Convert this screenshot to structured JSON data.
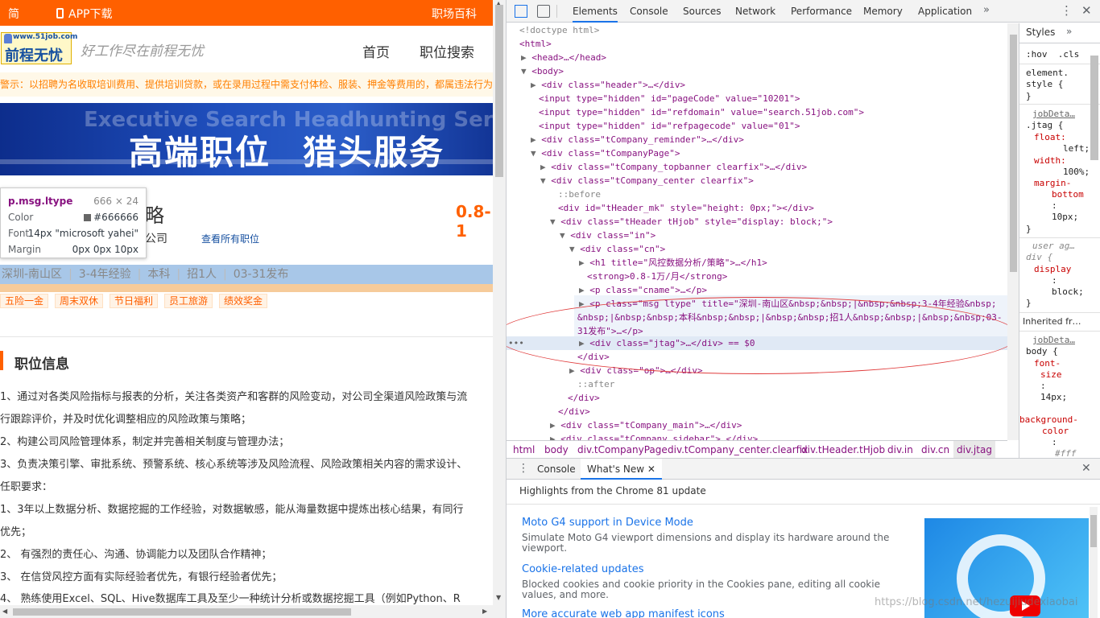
{
  "site": {
    "topbar": {
      "simplified": "简",
      "app_download": "APP下载",
      "career_wiki": "职场百科"
    },
    "logo": {
      "url_text": "www.51job.com",
      "name": "前程无忧"
    },
    "slogan": "好工作尽在前程无忧",
    "nav": [
      "首页",
      "职位搜索"
    ],
    "warning": "警示：以招聘为名收取培训费用、提供培训贷款，或在录用过程中需支付体检、服装、押金等费用的，都属违法行为",
    "banner": {
      "bg_text": "Executive Search  Headhunting Service",
      "title_left": "高端职位",
      "title_right": "猎头服务"
    },
    "job": {
      "title_tail": "略",
      "salary": "0.8-1",
      "company_tail": "公司",
      "view_all": "查看所有职位",
      "msg": [
        "深圳-南山区",
        "3-4年经验",
        "本科",
        "招1人",
        "03-31发布"
      ],
      "tags": [
        "五险一金",
        "周末双休",
        "节日福利",
        "员工旅游",
        "绩效奖金"
      ]
    },
    "section_title": "职位信息",
    "description": [
      "1、通过对各类风险指标与报表的分析，关注各类资产和客群的风险变动，对公司全渠道风险政策与流",
      "行跟踪评价，并及时优化调整相应的风险政策与策略；",
      "2、构建公司风险管理体系，制定并完善相关制度与管理办法；",
      "3、负责决策引擎、审批系统、预警系统、核心系统等涉及风险流程、风险政策相关内容的需求设计、",
      "任职要求：",
      "1、3年以上数据分析、数据挖掘的工作经验，对数据敏感，能从海量数据中提炼出核心结果，有同行",
      "优先；",
      "2、 有强烈的责任心、沟通、协调能力以及团队合作精神；",
      "3、 在信贷风控方面有实际经验者优先，有银行经验者优先；",
      "4、 熟练使用Excel、SQL、Hive数据库工具及至少一种统计分析或数据挖掘工具（例如Python、R"
    ]
  },
  "tooltip": {
    "selector": "p.msg.ltype",
    "dimensions": "666 × 24",
    "color_label": "Color",
    "color_value": "#666666",
    "font_label": "Font",
    "font_value": "14px \"microsoft yahei\"",
    "margin_label": "Margin",
    "margin_value": "0px 0px 10px"
  },
  "devtools": {
    "tabs": [
      "Elements",
      "Console",
      "Sources",
      "Network",
      "Performance",
      "Memory",
      "Application"
    ],
    "active_tab": "Elements",
    "more": "»",
    "dom_lines": [
      "<!doctype html>",
      "<html>",
      "<head>…</head>",
      "<body>",
      "<div class=\"header\">…</div>",
      "<input type=\"hidden\" id=\"pageCode\" value=\"10201\">",
      "<input type=\"hidden\" id=\"refdomain\" value=\"search.51job.com\">",
      "<input type=\"hidden\" id=\"refpagecode\" value=\"01\">",
      "<div class=\"tCompany_reminder\">…</div>",
      "<div class=\"tCompanyPage\">",
      "<div class=\"tCompany_topbanner clearfix\">…</div>",
      "<div class=\"tCompany_center clearfix\">",
      "::before",
      "<div id=\"tHeader_mk\" style=\"height: 0px;\"></div>",
      "<div class=\"tHeader tHjob\" style=\"display: block;\">",
      "<div class=\"in\">",
      "<div class=\"cn\">",
      "<h1 title=\"风控数据分析/策略\">…</h1>",
      "<strong>0.8-1万/月</strong>",
      "<p class=\"cname\">…</p>",
      "<p class=\"msg ltype\" title=\"深圳-南山区&nbsp;&nbsp;|&nbsp;&nbsp;3-4年经验&nbsp;",
      "&nbsp;|&nbsp;&nbsp;本科&nbsp;&nbsp;|&nbsp;&nbsp;招1人&nbsp;&nbsp;|&nbsp;&nbsp;03-",
      "31发布\">…</p>",
      "<div class=\"jtag\">…</div> == $0",
      "</div>",
      "<div class=\"op\">…</div>",
      "::after",
      "</div>",
      "</div>",
      "<div class=\"tCompany_main\">…</div>",
      "<div class=\"tCompany_sidebar\">…</div>"
    ],
    "breadcrumbs": [
      "html",
      "body",
      "div.tCompanyPage",
      "div.tCompany_center.clearfix",
      "div.tHeader.tHjob",
      "div.in",
      "div.cn",
      "div.jtag"
    ],
    "styles_pane": {
      "tab": "Styles",
      "filter": ":hov  .cls",
      "lines": [
        "element.",
        "style {",
        "}",
        "jobDeta…",
        ".jtag {",
        "float:",
        "left;",
        "width:",
        "100%;",
        "margin-",
        "bottom",
        ":",
        "10px;",
        "}",
        "user ag…",
        "div {",
        "display",
        ":",
        "block;",
        "}",
        "Inherited fr…",
        "jobDeta…",
        "body {",
        "font-",
        "size",
        ":",
        "14px;",
        "background-",
        "color",
        ":",
        "#fff"
      ]
    },
    "drawer": {
      "tabs": [
        "Console",
        "What's New"
      ],
      "active_tab": "What's New",
      "headline": "Highlights from the Chrome 81 update",
      "items": [
        {
          "title": "Moto G4 support in Device Mode",
          "desc": "Simulate Moto G4 viewport dimensions and display its hardware around the viewport."
        },
        {
          "title": "Cookie-related updates",
          "desc": "Blocked cookies and cookie priority in the Cookies pane, editing all cookie values, and more."
        },
        {
          "title": "More accurate web app manifest icons",
          "desc": ""
        }
      ]
    }
  },
  "watermark": "https://blog.csdn.net/hezuijiudexiaobai"
}
